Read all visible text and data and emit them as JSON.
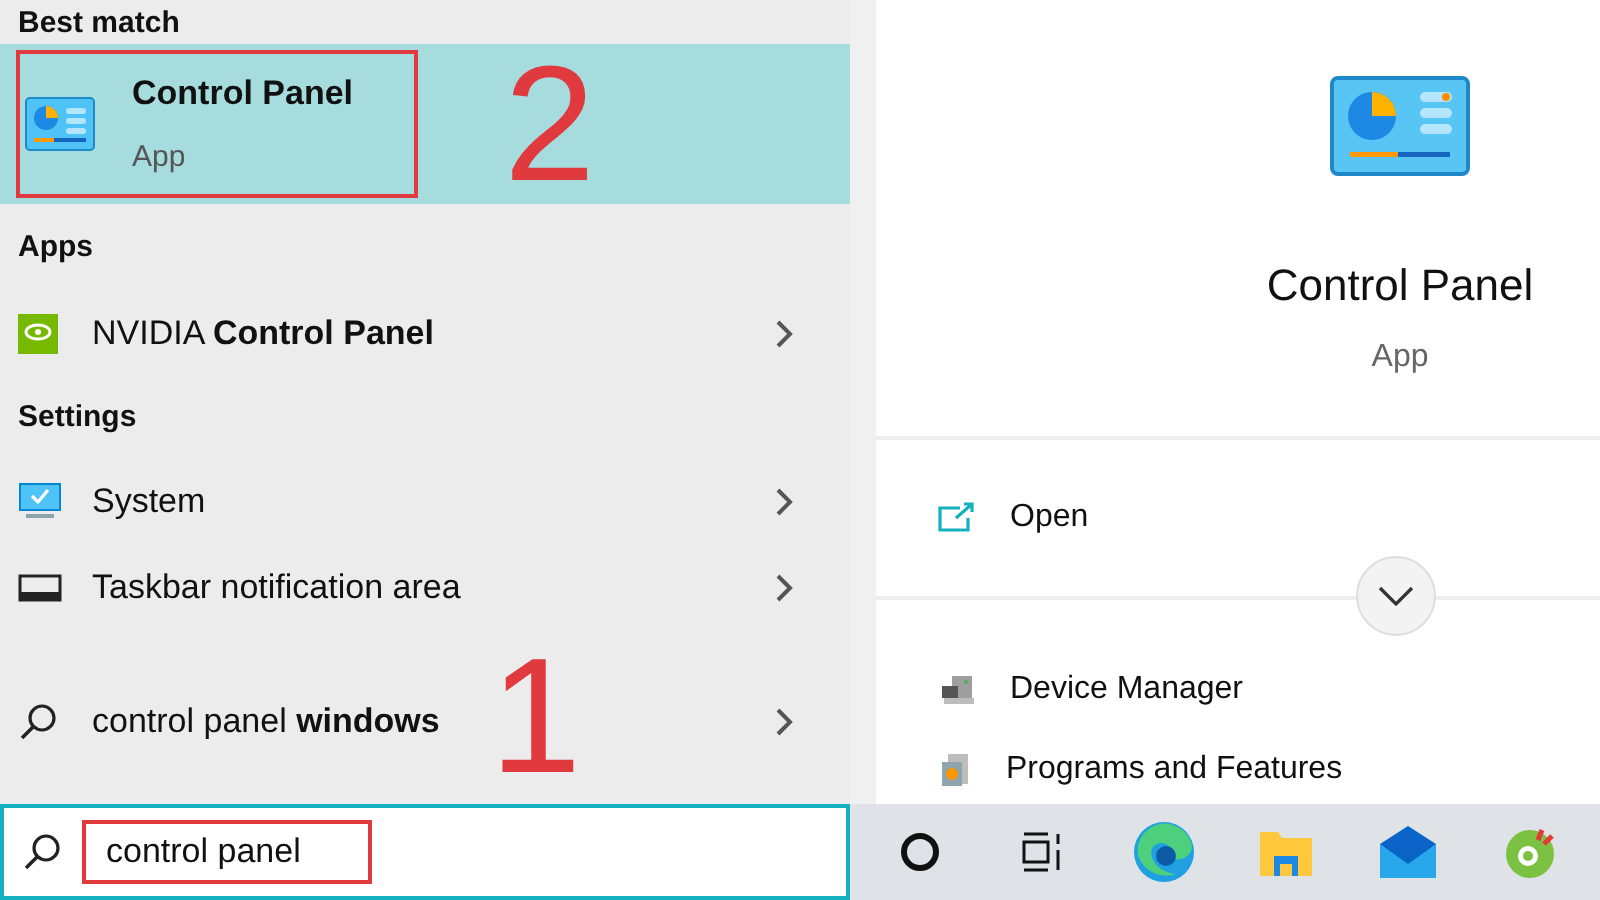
{
  "search_results": {
    "sections": [
      {
        "header": "Best match",
        "items": [
          {
            "kind": "control-panel",
            "title": "Control Panel",
            "subtitle": "App",
            "selected": true
          }
        ]
      },
      {
        "header": "Apps",
        "items": [
          {
            "kind": "nvidia",
            "title": "NVIDIA **Control Panel**",
            "selected": false
          }
        ]
      },
      {
        "header": "Settings",
        "items": [
          {
            "kind": "system",
            "title": "System",
            "selected": false
          },
          {
            "kind": "taskbar",
            "title": "Taskbar notification area",
            "selected": false
          }
        ]
      },
      {
        "items": [
          {
            "kind": "search",
            "title": "control panel **windows**",
            "selected": false
          }
        ]
      }
    ]
  },
  "search_box": {
    "value": "control panel"
  },
  "preview": {
    "title": "Control Panel",
    "subtitle": "App",
    "actions": [
      {
        "kind": "open",
        "label": "Open"
      }
    ],
    "related": [
      {
        "kind": "device-manager",
        "label": "Device Manager"
      },
      {
        "kind": "programs",
        "label": "Programs and Features"
      }
    ]
  },
  "taskbar": {
    "items": [
      {
        "kind": "cortana"
      },
      {
        "kind": "task-view"
      },
      {
        "kind": "edge"
      },
      {
        "kind": "explorer"
      },
      {
        "kind": "mail"
      },
      {
        "kind": "browser"
      }
    ]
  },
  "annotations": [
    {
      "label": "2"
    },
    {
      "label": "1"
    }
  ]
}
